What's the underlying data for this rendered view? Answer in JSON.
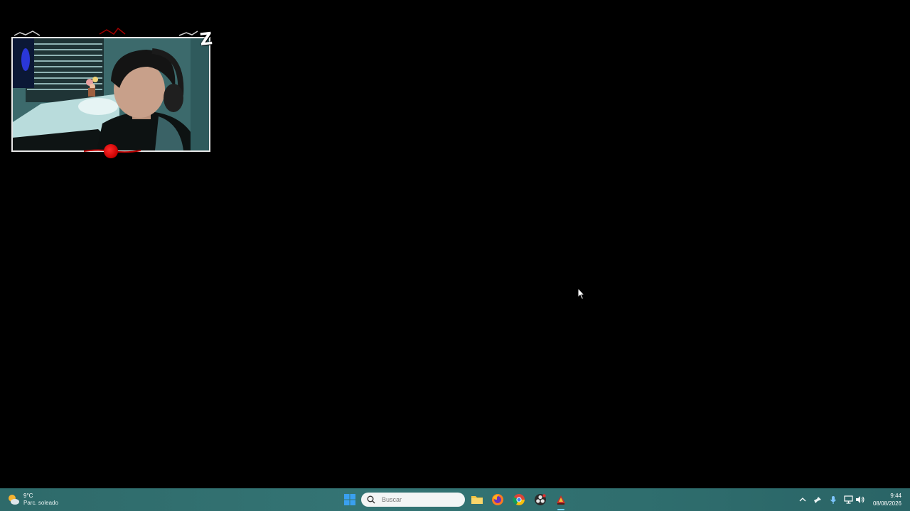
{
  "webcam": {
    "logo_text": "Z"
  },
  "taskbar": {
    "weather": {
      "temperature": "9°C",
      "condition": "Parc. soleado",
      "icon": "partly-sunny-icon"
    },
    "search_placeholder": "Buscar",
    "pinned_apps": [
      {
        "name": "start-button",
        "icon": "windows-icon"
      },
      {
        "name": "file-explorer",
        "icon": "folder-icon"
      },
      {
        "name": "firefox",
        "icon": "firefox-icon"
      },
      {
        "name": "chrome",
        "icon": "chrome-icon"
      },
      {
        "name": "obs",
        "icon": "obs-icon"
      },
      {
        "name": "game-app",
        "icon": "game-icon"
      }
    ],
    "tray_icons": [
      "chevron-up-icon",
      "steam-icon",
      "microphone-icon",
      "network-icon",
      "volume-icon"
    ],
    "clock": {
      "time": "9:44",
      "date": "08/08/2026"
    },
    "accent_color": "#347474"
  }
}
